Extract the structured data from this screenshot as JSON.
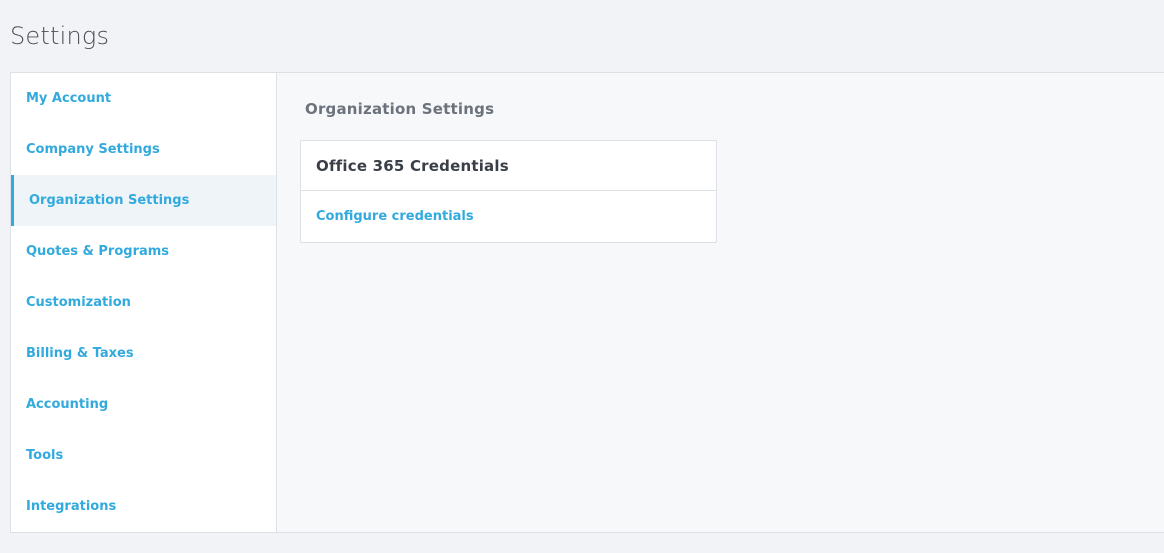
{
  "page": {
    "title": "Settings"
  },
  "sidebar": {
    "items": [
      {
        "label": "My Account"
      },
      {
        "label": "Company Settings"
      },
      {
        "label": "Organization Settings"
      },
      {
        "label": "Quotes & Programs"
      },
      {
        "label": "Customization"
      },
      {
        "label": "Billing & Taxes"
      },
      {
        "label": "Accounting"
      },
      {
        "label": "Tools"
      },
      {
        "label": "Integrations"
      }
    ],
    "active_index": 2
  },
  "main": {
    "heading": "Organization Settings",
    "card": {
      "title": "Office 365 Credentials",
      "link": "Configure credentials"
    }
  },
  "colors": {
    "accent": "#33aadd",
    "page_bg": "#f1f3f6",
    "text_dark": "#3a3f47",
    "text_muted": "#6c737d"
  }
}
